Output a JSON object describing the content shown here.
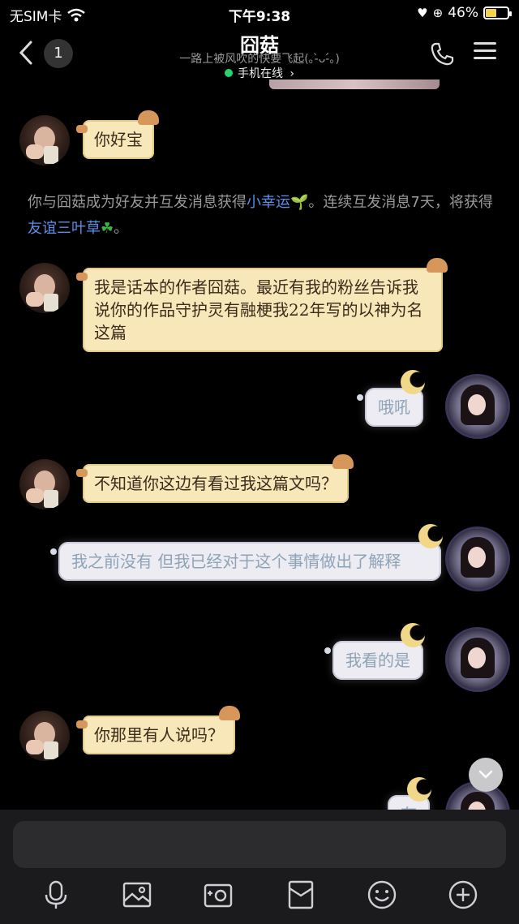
{
  "status_bar": {
    "carrier": "无SIM卡",
    "time": "下午9:38",
    "battery_percent": "46%",
    "battery_level": 0.46
  },
  "header": {
    "back_count": "1",
    "title": "囧菇",
    "signature": "一路上被风吹的快要飞起(｡-̀ᴗ-́｡)",
    "online_status": "手机在线",
    "online_chevron": "›"
  },
  "messages": [
    {
      "side": "left",
      "text": "你好宝"
    },
    {
      "side": "system",
      "prefix": "你与囧菇成为好友并互发消息获得",
      "link1": "小幸运",
      "middle": "。连续互发消息7天，将获得",
      "link2": "友谊三叶草",
      "suffix": "。"
    },
    {
      "side": "left",
      "text": "我是话本的作者囧菇。最近有我的粉丝告诉我说你的作品守护灵有融梗我22年写的以神为名这篇"
    },
    {
      "side": "right",
      "text": "哦吼"
    },
    {
      "side": "left",
      "text": "不知道你这边有看过我这篇文吗？"
    },
    {
      "side": "right",
      "text": "我之前没有 但我已经对于这个事情做出了解释"
    },
    {
      "side": "right",
      "text": "我看的是"
    },
    {
      "side": "left",
      "text": "你那里有人说吗？"
    },
    {
      "side": "right",
      "text": "有"
    }
  ],
  "input": {
    "placeholder": ""
  },
  "toolbar": [
    "microphone-icon",
    "image-icon",
    "camera-icon",
    "red-packet-icon",
    "emoji-icon",
    "plus-icon"
  ],
  "colors": {
    "online_dot": "#27d36b",
    "link": "#5b8ee8",
    "left_bubble": "#f7e7b9",
    "right_bubble": "#ececf2"
  }
}
